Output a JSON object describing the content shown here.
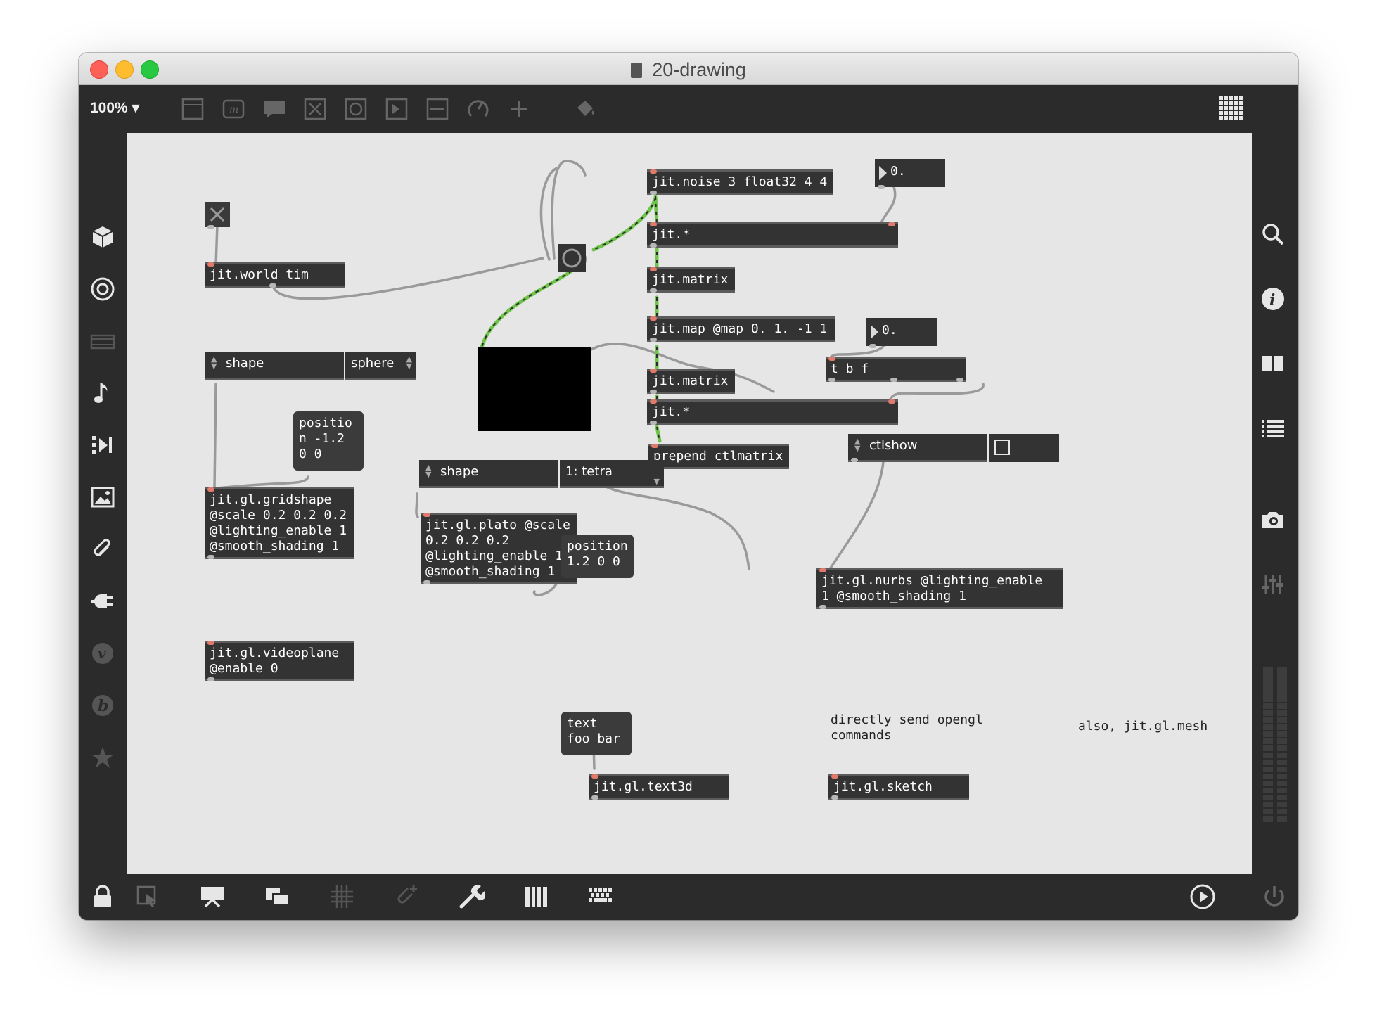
{
  "window": {
    "title": "20-drawing"
  },
  "toolbar": {
    "zoom": "100%",
    "tools": [
      "new-object-icon",
      "message-icon",
      "comment-icon",
      "toggle-icon",
      "button-icon",
      "number-icon",
      "slider-icon",
      "dial-icon",
      "add-icon",
      "paint-bucket-icon"
    ],
    "grid_icon": "dot-grid-icon"
  },
  "left_rail": [
    "cube-icon",
    "target-icon",
    "film-icon",
    "music-note-icon",
    "playlist-icon",
    "image-icon",
    "paperclip-icon",
    "plug-icon",
    "v-icon",
    "b-icon",
    "star-icon"
  ],
  "right_rail": [
    "search-icon",
    "info-icon",
    "book-icon",
    "list-icon",
    "camera-icon",
    "mixer-icon"
  ],
  "bottom_bar": [
    "lock-icon",
    "select-icon",
    "presentation-icon",
    "windows-icon",
    "grid-icon",
    "patch-cords-icon",
    "wrench-icon",
    "keyboard-piano-icon",
    "computer-keyboard-icon",
    "transport-play-icon",
    "power-icon"
  ],
  "patch": {
    "objects": {
      "noise": "jit.noise 3 float32 4 4",
      "mul1": "jit.*",
      "matrix1": "jit.matrix",
      "map": "jit.map @map 0. 1. -1 1",
      "matrix2": "jit.matrix",
      "mul2": "jit.*",
      "prepend": "prepend ctlmatrix",
      "world": "jit.world tim",
      "tbf": "t b f",
      "gridshape": "jit.gl.gridshape\n@scale 0.2 0.2 0.2\n@lighting_enable 1\n@smooth_shading 1",
      "plato": "jit.gl.plato @scale\n0.2 0.2 0.2\n@lighting_enable 1\n@smooth_shading 1",
      "nurbs": "jit.gl.nurbs @lighting_enable\n1 @smooth_shading 1",
      "videoplane": "jit.gl.videoplane\n@enable 0",
      "text3d": "jit.gl.text3d",
      "sketch": "jit.gl.sketch"
    },
    "numbers": {
      "num1": "0.",
      "num2": "0."
    },
    "menus": {
      "shape1_label": "shape",
      "shape1_value": "sphere",
      "shape2_label": "shape",
      "shape2_value": "1: tetra",
      "ctlshow_label": "ctlshow"
    },
    "messages": {
      "position1": "positio\nn -1.2\n0 0",
      "position2": "position\n1.2 0 0",
      "text": "text\nfoo bar"
    },
    "comments": {
      "opengl": "directly send opengl\ncommands",
      "mesh": "also, jit.gl.mesh"
    }
  }
}
